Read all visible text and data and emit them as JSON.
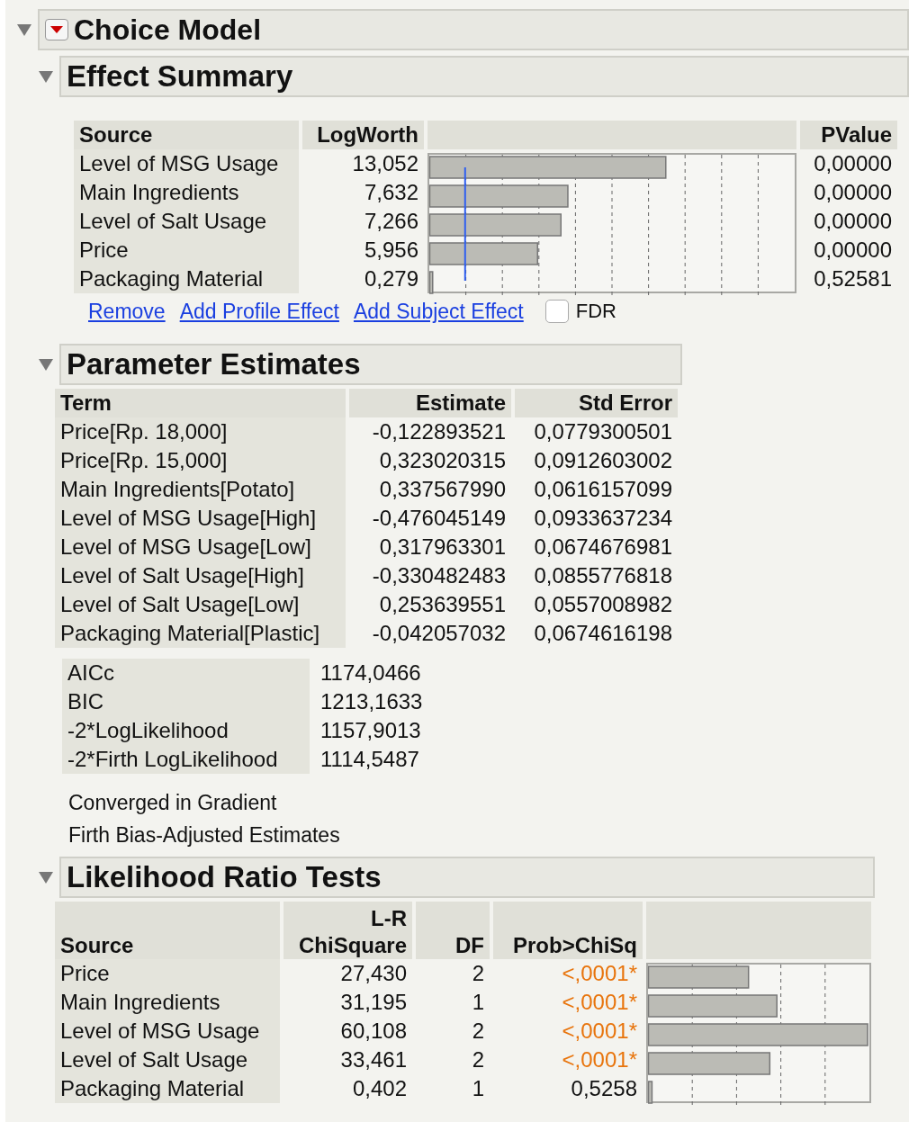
{
  "title": "Choice Model",
  "effect_summary": {
    "title": "Effect Summary",
    "expanded": true,
    "columns": [
      "Source",
      "LogWorth",
      "PValue"
    ],
    "rows": [
      {
        "source": "Level of MSG Usage",
        "logworth": "13,052",
        "level": 0.646,
        "pvalue": "0,00000"
      },
      {
        "source": "Main Ingredients",
        "logworth": "7,632",
        "level": 0.378,
        "pvalue": "0,00000"
      },
      {
        "source": "Level of Salt Usage",
        "logworth": "7,266",
        "level": 0.359,
        "pvalue": "0,00000"
      },
      {
        "source": "Price",
        "logworth": "5,956",
        "level": 0.295,
        "pvalue": "0,00000"
      },
      {
        "source": "Packaging Material",
        "logworth": "0,279",
        "level": 0.008,
        "pvalue": "0,52581"
      }
    ],
    "links": [
      "Remove",
      "Add Profile Effect",
      "Add Subject Effect"
    ],
    "fdr": {
      "label": "FDR",
      "checked": false
    }
  },
  "parameter_estimates": {
    "title": "Parameter Estimates",
    "expanded": true,
    "columns": [
      "Term",
      "Estimate",
      "Std Error"
    ],
    "rows": [
      {
        "term": "Price[Rp. 18,000]",
        "estimate": "-0,122893521",
        "std_error": "0,0779300501"
      },
      {
        "term": "Price[Rp. 15,000]",
        "estimate": "0,323020315",
        "std_error": "0,0912603002"
      },
      {
        "term": "Main Ingredients[Potato]",
        "estimate": "0,337567990",
        "std_error": "0,0616157099"
      },
      {
        "term": "Level of MSG Usage[High]",
        "estimate": "-0,476045149",
        "std_error": "0,0933637234"
      },
      {
        "term": "Level of MSG Usage[Low]",
        "estimate": "0,317963301",
        "std_error": "0,0674676981"
      },
      {
        "term": "Level of Salt Usage[High]",
        "estimate": "-0,330482483",
        "std_error": "0,0855776818"
      },
      {
        "term": "Level of Salt Usage[Low]",
        "estimate": "0,253639551",
        "std_error": "0,0557008982"
      },
      {
        "term": "Packaging Material[Plastic]",
        "estimate": "-0,042057032",
        "std_error": "0,0674616198"
      }
    ],
    "fit_statistics": [
      {
        "label": "AICc",
        "value": "1174,0466"
      },
      {
        "label": "BIC",
        "value": "1213,1633"
      },
      {
        "label": "-2*LogLikelihood",
        "value": "1157,9013"
      },
      {
        "label": "-2*Firth LogLikelihood",
        "value": "1114,5487"
      }
    ],
    "notes": [
      "Converged in Gradient",
      "Firth Bias-Adjusted Estimates"
    ]
  },
  "likelihood_ratio_tests": {
    "title": "Likelihood Ratio Tests",
    "expanded": true,
    "columns": [
      "Source",
      "L-R\nChiSquare",
      "DF",
      "Prob>ChiSq"
    ],
    "rows": [
      {
        "source": "Price",
        "chisquare": "27,430",
        "df": "2",
        "prob": "<,0001*",
        "significant": true,
        "level": 0.452
      },
      {
        "source": "Main Ingredients",
        "chisquare": "31,195",
        "df": "1",
        "prob": "<,0001*",
        "significant": true,
        "level": 0.58
      },
      {
        "source": "Level of MSG Usage",
        "chisquare": "60,108",
        "df": "2",
        "prob": "<,0001*",
        "significant": true,
        "level": 0.99
      },
      {
        "source": "Level of Salt Usage",
        "chisquare": "33,461",
        "df": "2",
        "prob": "<,0001*",
        "significant": true,
        "level": 0.548
      },
      {
        "source": "Packaging Material",
        "chisquare": "0,402",
        "df": "1",
        "prob": "0,5258",
        "significant": false,
        "level": 0.016
      }
    ]
  }
}
